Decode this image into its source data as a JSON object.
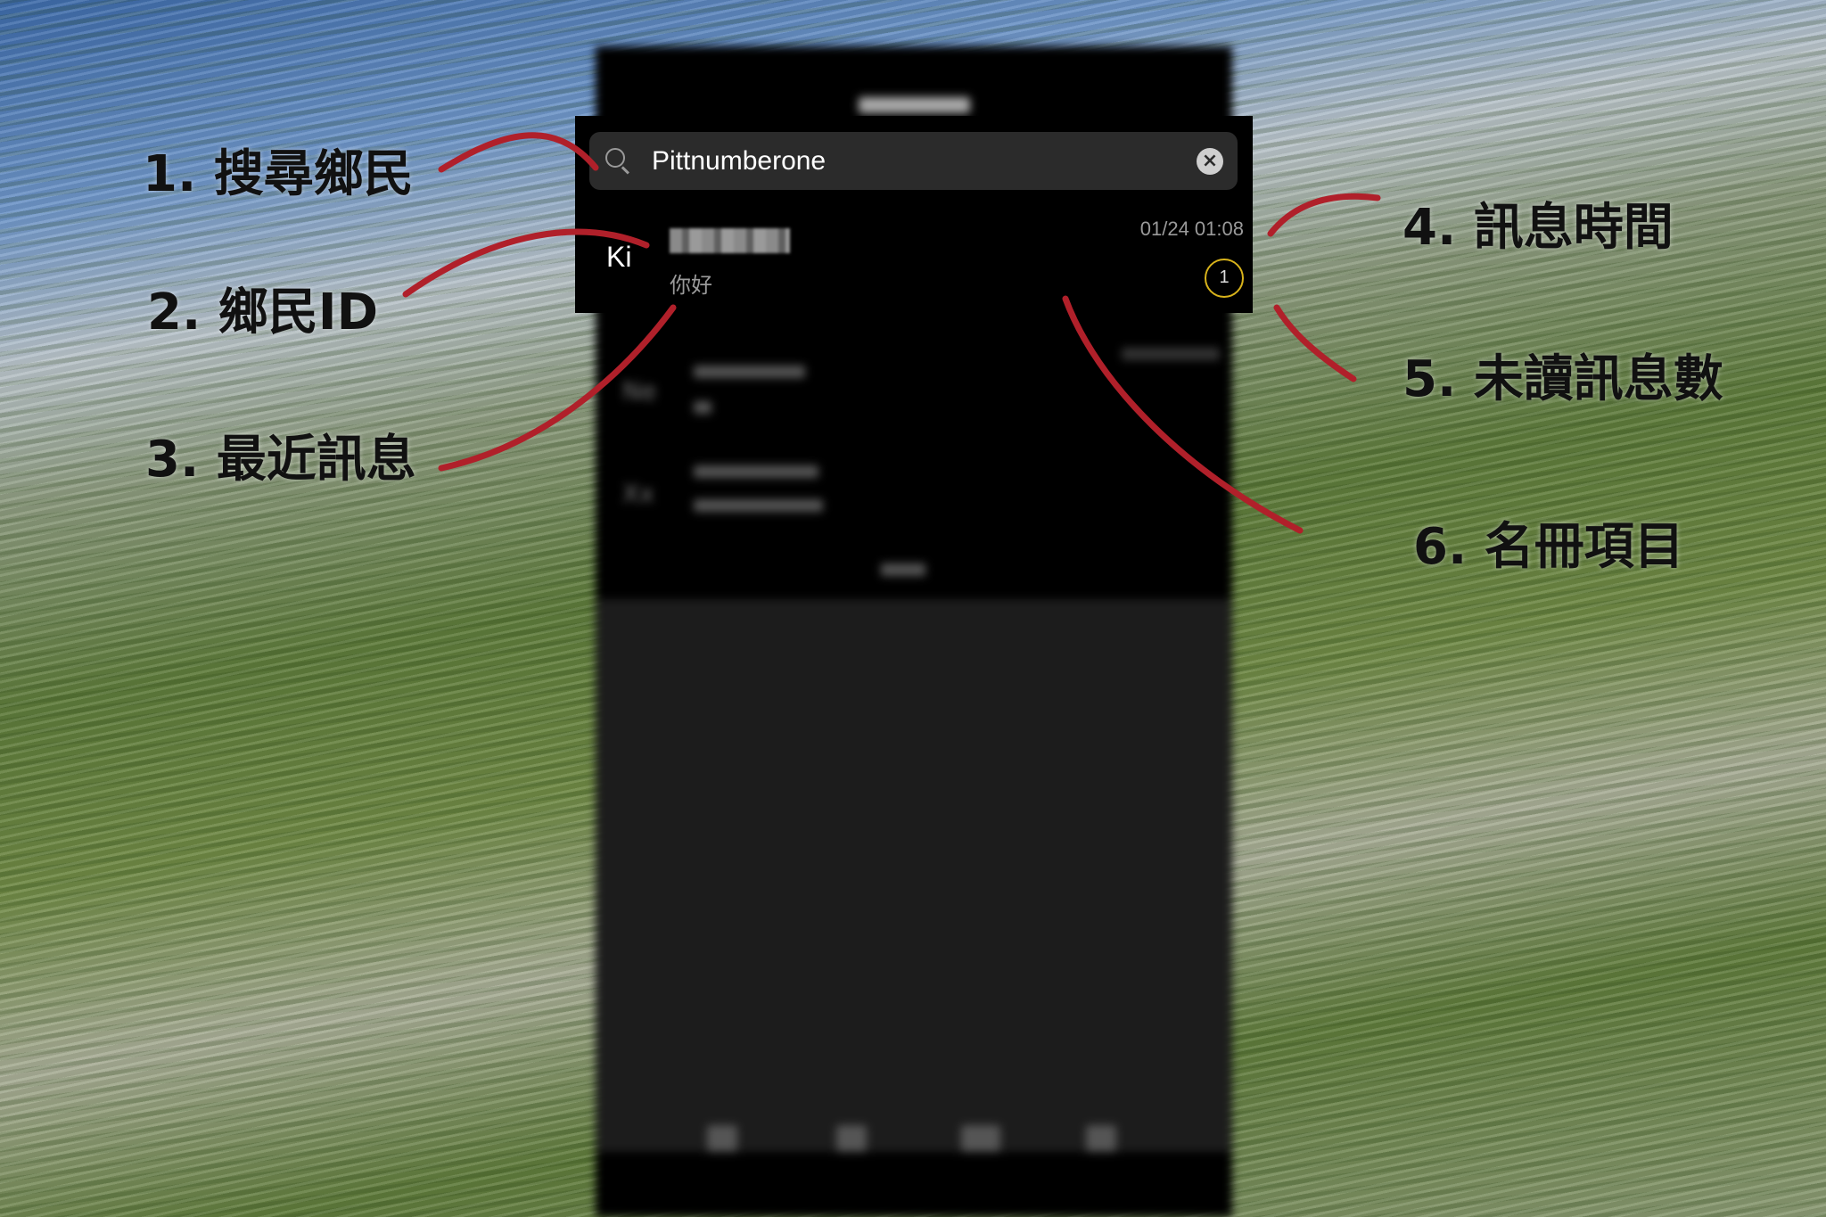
{
  "search": {
    "value": "Pittnumberone"
  },
  "result_row": {
    "avatar": "Ki",
    "last_message": "你好",
    "time": "01/24 01:08",
    "unread_count": "1"
  },
  "annotations": [
    "1. 搜尋鄉民",
    "2. 鄉民ID",
    "3. 最近訊息",
    "4. 訊息時間",
    "5. 未讀訊息數",
    "6. 名冊項目"
  ],
  "colors": {
    "arrow": "#b0202a",
    "badge_ring": "#d8b31b"
  },
  "icons": [
    "search-icon",
    "clear-icon"
  ]
}
